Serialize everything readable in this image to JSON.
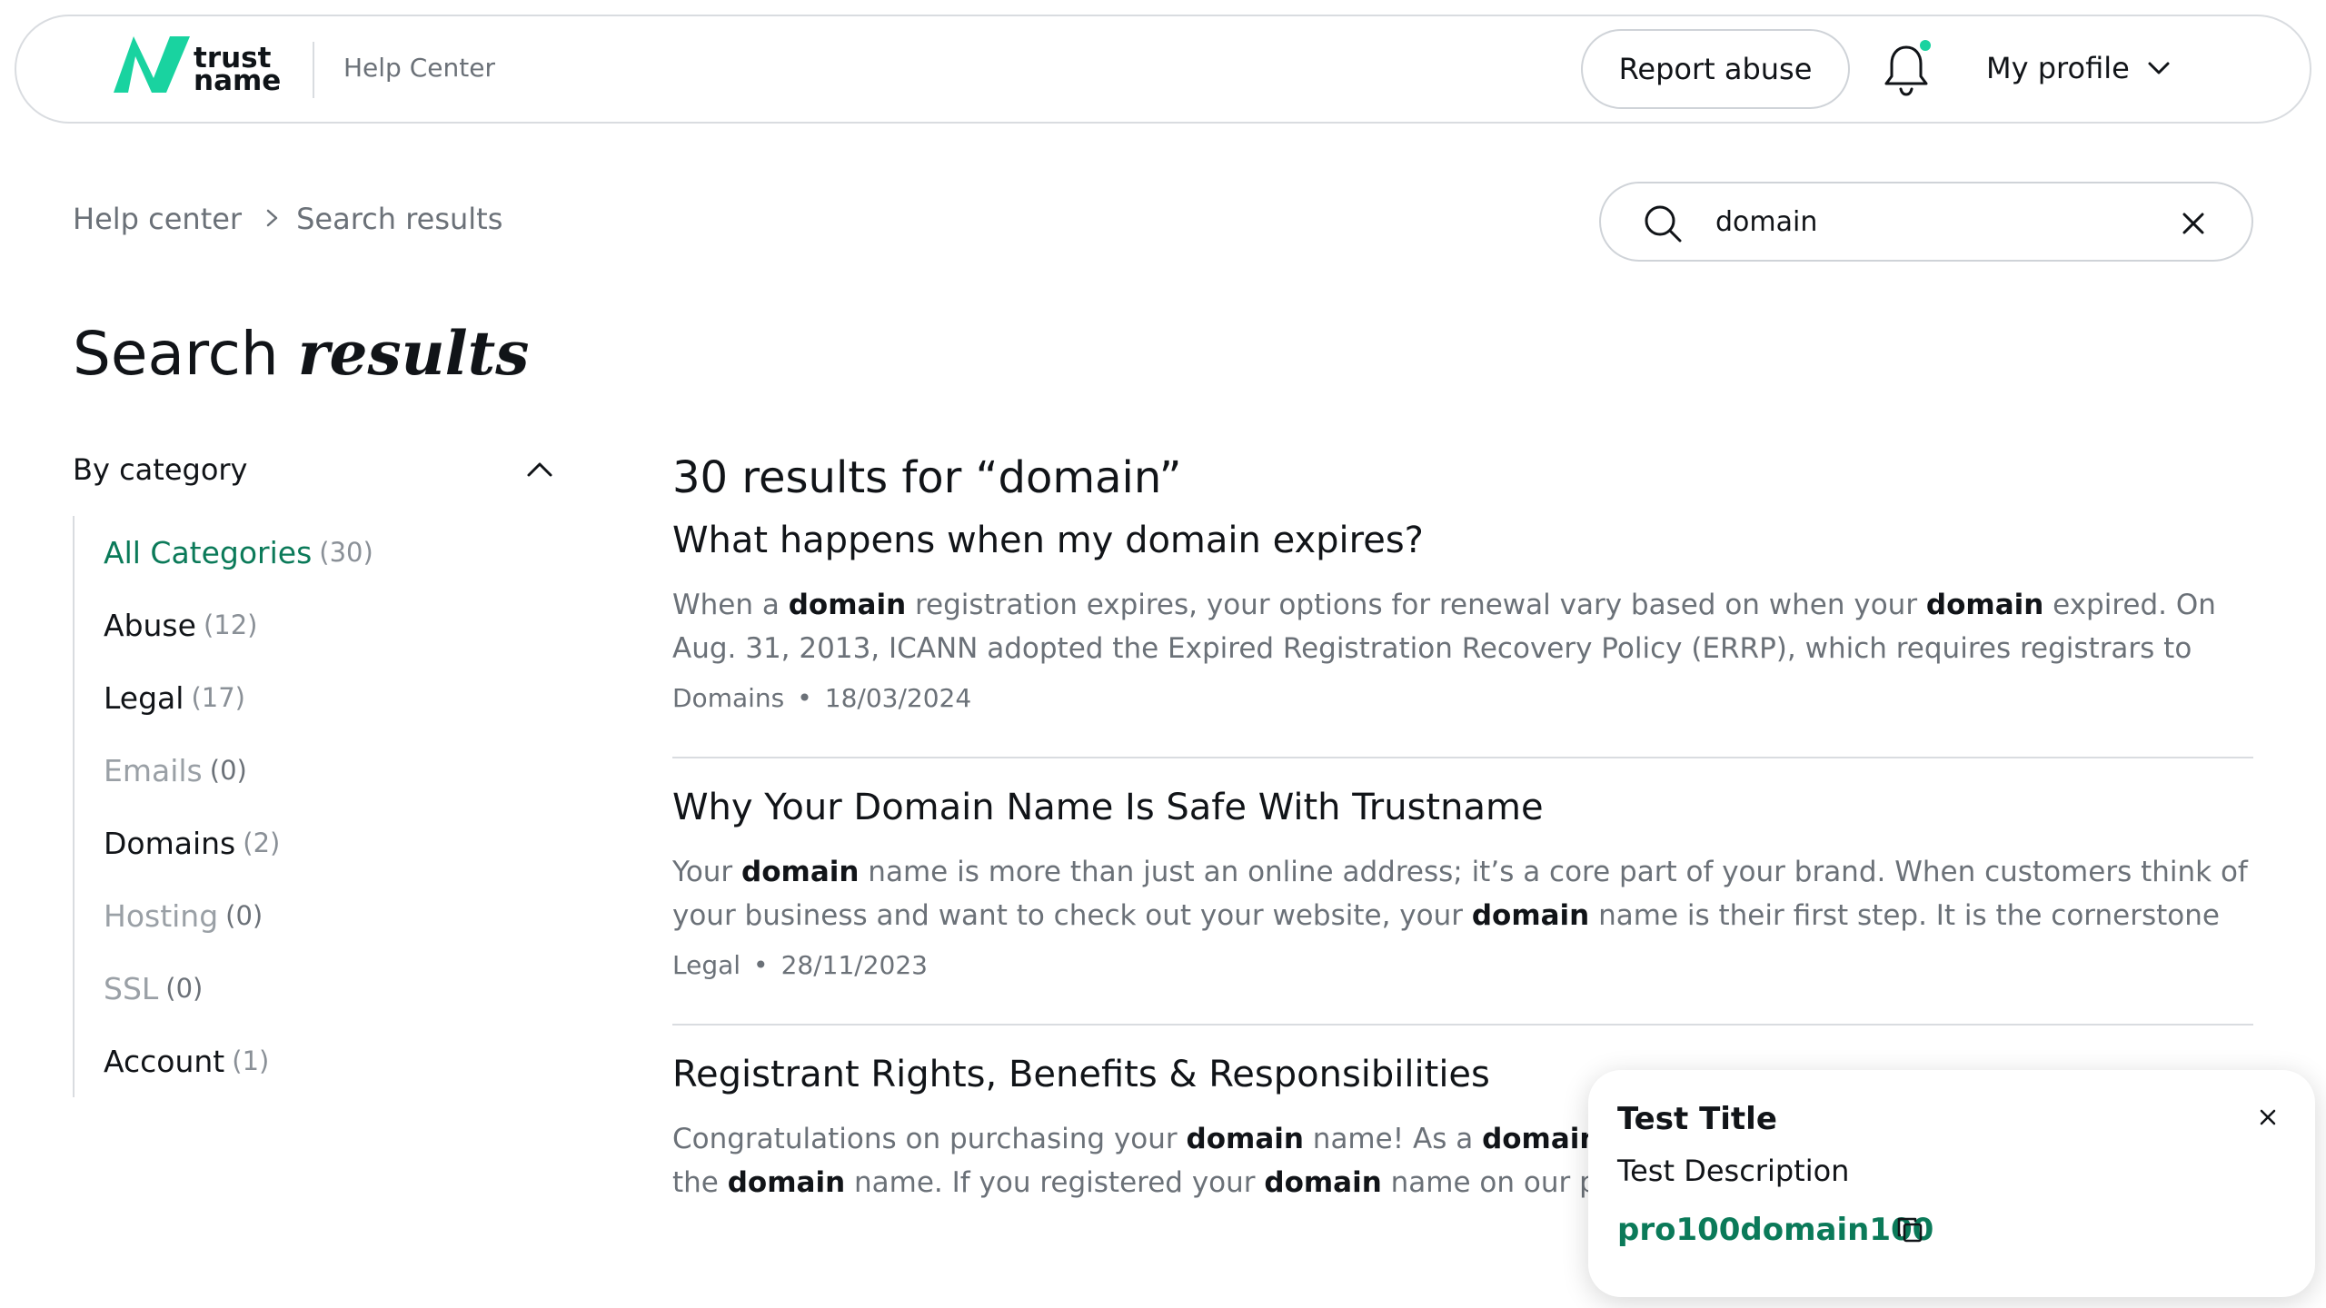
{
  "header": {
    "logo_line1": "trust",
    "logo_line2": "name",
    "section_label": "Help Center",
    "report_button": "Report abuse",
    "profile_label": "My profile",
    "notification_dot_color": "#19d3a0",
    "brand_color": "#19d3a0"
  },
  "breadcrumb": {
    "items": [
      "Help center",
      "Search results"
    ]
  },
  "search": {
    "value": "domain",
    "placeholder": "Search"
  },
  "page": {
    "title_plain": "Search ",
    "title_emphasis": "results"
  },
  "sidebar": {
    "heading": "By category",
    "categories": [
      {
        "name": "All Categories",
        "count": "(30)",
        "state": "active"
      },
      {
        "name": "Abuse",
        "count": "(12)",
        "state": "normal"
      },
      {
        "name": "Legal",
        "count": "(17)",
        "state": "normal"
      },
      {
        "name": "Emails",
        "count": "(0)",
        "state": "disabled"
      },
      {
        "name": "Domains",
        "count": "(2)",
        "state": "normal"
      },
      {
        "name": "Hosting",
        "count": "(0)",
        "state": "disabled"
      },
      {
        "name": "SSL",
        "count": "(0)",
        "state": "disabled"
      },
      {
        "name": "Account",
        "count": "(1)",
        "state": "normal"
      }
    ]
  },
  "results": {
    "heading": "30 results for “domain”",
    "items": [
      {
        "title": "What happens when my domain expires?",
        "snippet": [
          {
            "t": "When a ",
            "b": false
          },
          {
            "t": "domain",
            "b": true
          },
          {
            "t": " registration expires, your options for renewal vary based on when your ",
            "b": false
          },
          {
            "t": "domain",
            "b": true
          },
          {
            "t": " expired. On Aug. 31, 2013, ICANN adopted the Expired Registration Recovery Policy (ERRP), which requires registrars to disclose important…",
            "b": false
          }
        ],
        "category": "Domains",
        "date": "18/03/2024"
      },
      {
        "title": "Why Your Domain Name Is Safe With Trustname",
        "snippet": [
          {
            "t": "Your ",
            "b": false
          },
          {
            "t": "domain",
            "b": true
          },
          {
            "t": " name is more than just an online address; it’s a core part of your brand. When customers think of your business and want to check out your website, your ",
            "b": false
          },
          {
            "t": "domain",
            "b": true
          },
          {
            "t": " name is their first step. It is the cornerstone for engaging…",
            "b": false
          }
        ],
        "category": "Legal",
        "date": "28/11/2023"
      },
      {
        "title": "Registrant Rights, Benefits & Responsibilities",
        "snippet": [
          {
            "t": "Congratulations on purchasing your ",
            "b": false
          },
          {
            "t": "domain",
            "b": true
          },
          {
            "t": " name! As a ",
            "b": false
          },
          {
            "t": "domain",
            "b": true
          },
          {
            "t": " name registrant, you are the legal owner of the ",
            "b": false
          },
          {
            "t": "domain",
            "b": true
          },
          {
            "t": " name. If you registered your ",
            "b": false
          },
          {
            "t": "domain",
            "b": true
          },
          {
            "t": " name on our platform, you can…",
            "b": false
          }
        ],
        "category": "",
        "date": ""
      }
    ]
  },
  "toast": {
    "title": "Test Title",
    "description": "Test Description",
    "code": "pro100domain100",
    "code_color": "#0b7a59"
  }
}
